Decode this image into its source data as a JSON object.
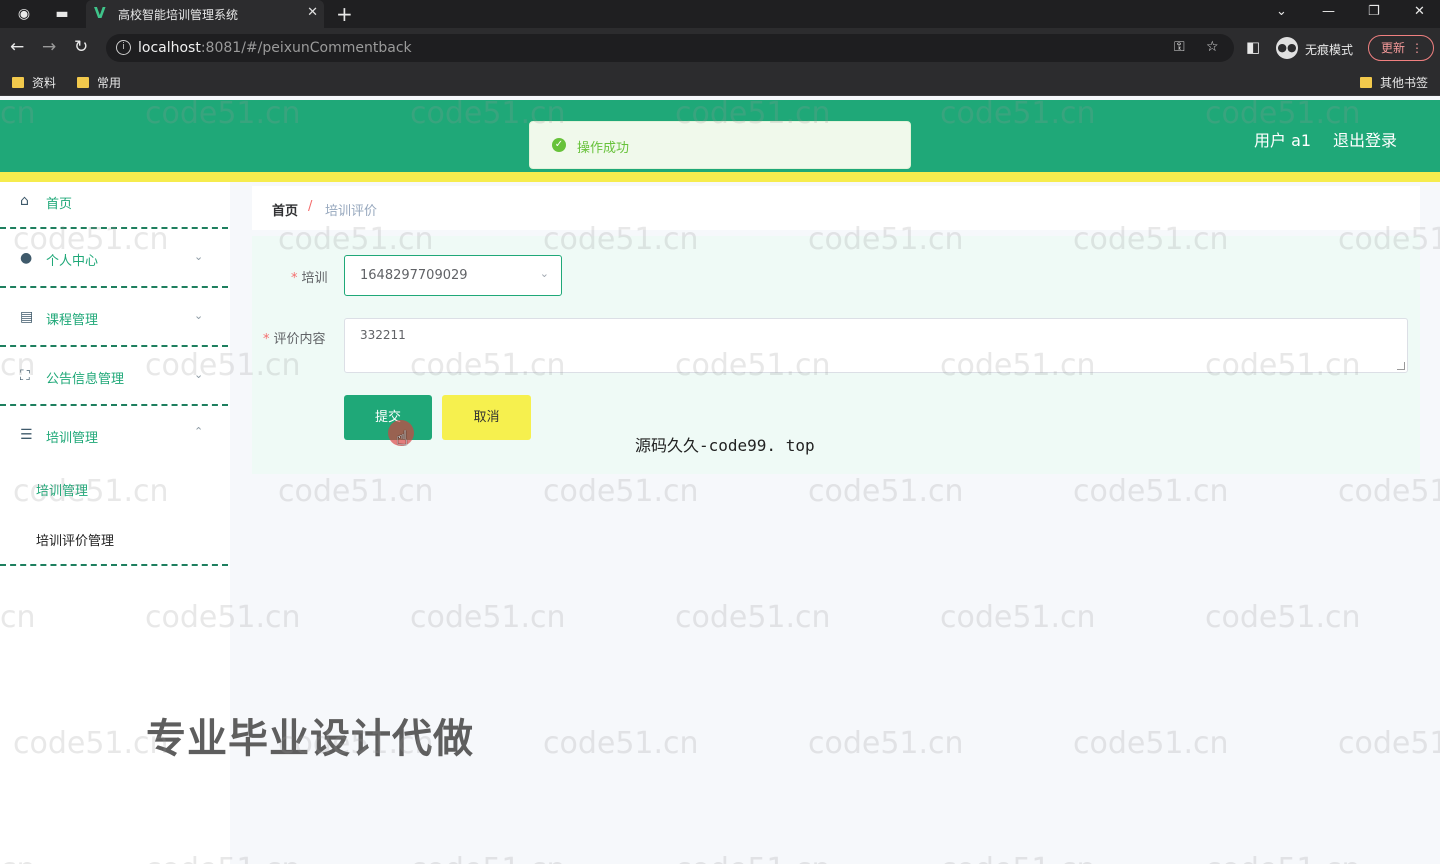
{
  "browser": {
    "tab_title": "高校智能培训管理系统",
    "url_host": "localhost",
    "url_path": ":8081/#/peixunCommentback",
    "incognito_label": "无痕模式",
    "update_label": "更新",
    "bookmarks": [
      {
        "label": "资料"
      },
      {
        "label": "常用"
      }
    ],
    "other_bookmarks": "其他书签"
  },
  "header": {
    "user_label": "用户 a1",
    "logout_label": "退出登录"
  },
  "toast": {
    "message": "操作成功"
  },
  "sidebar": {
    "items": [
      {
        "label": "首页",
        "icon": "home-icon"
      },
      {
        "label": "个人中心",
        "icon": "user-icon"
      },
      {
        "label": "课程管理",
        "icon": "chart-icon"
      },
      {
        "label": "公告信息管理",
        "icon": "fullscreen-icon"
      },
      {
        "label": "培训管理",
        "icon": "list-icon"
      }
    ],
    "sub_items": [
      {
        "label": "培训管理"
      },
      {
        "label": "培训评价管理"
      }
    ]
  },
  "breadcrumb": {
    "home": "首页",
    "separator": "/",
    "current": "培训评价"
  },
  "form": {
    "training_label": "培训",
    "training_value": "1648297709029",
    "comment_label": "评价内容",
    "comment_value": "332211",
    "submit_label": "提交",
    "cancel_label": "取消"
  },
  "overlays": {
    "code99": "源码久久-code99. top",
    "promo": "专业毕业设计代做",
    "watermark": "code51.cn"
  },
  "colors": {
    "header": "#1fa878",
    "accent_line": "#f6ec4e",
    "submit": "#1fa878",
    "cancel": "#f6f04e"
  }
}
